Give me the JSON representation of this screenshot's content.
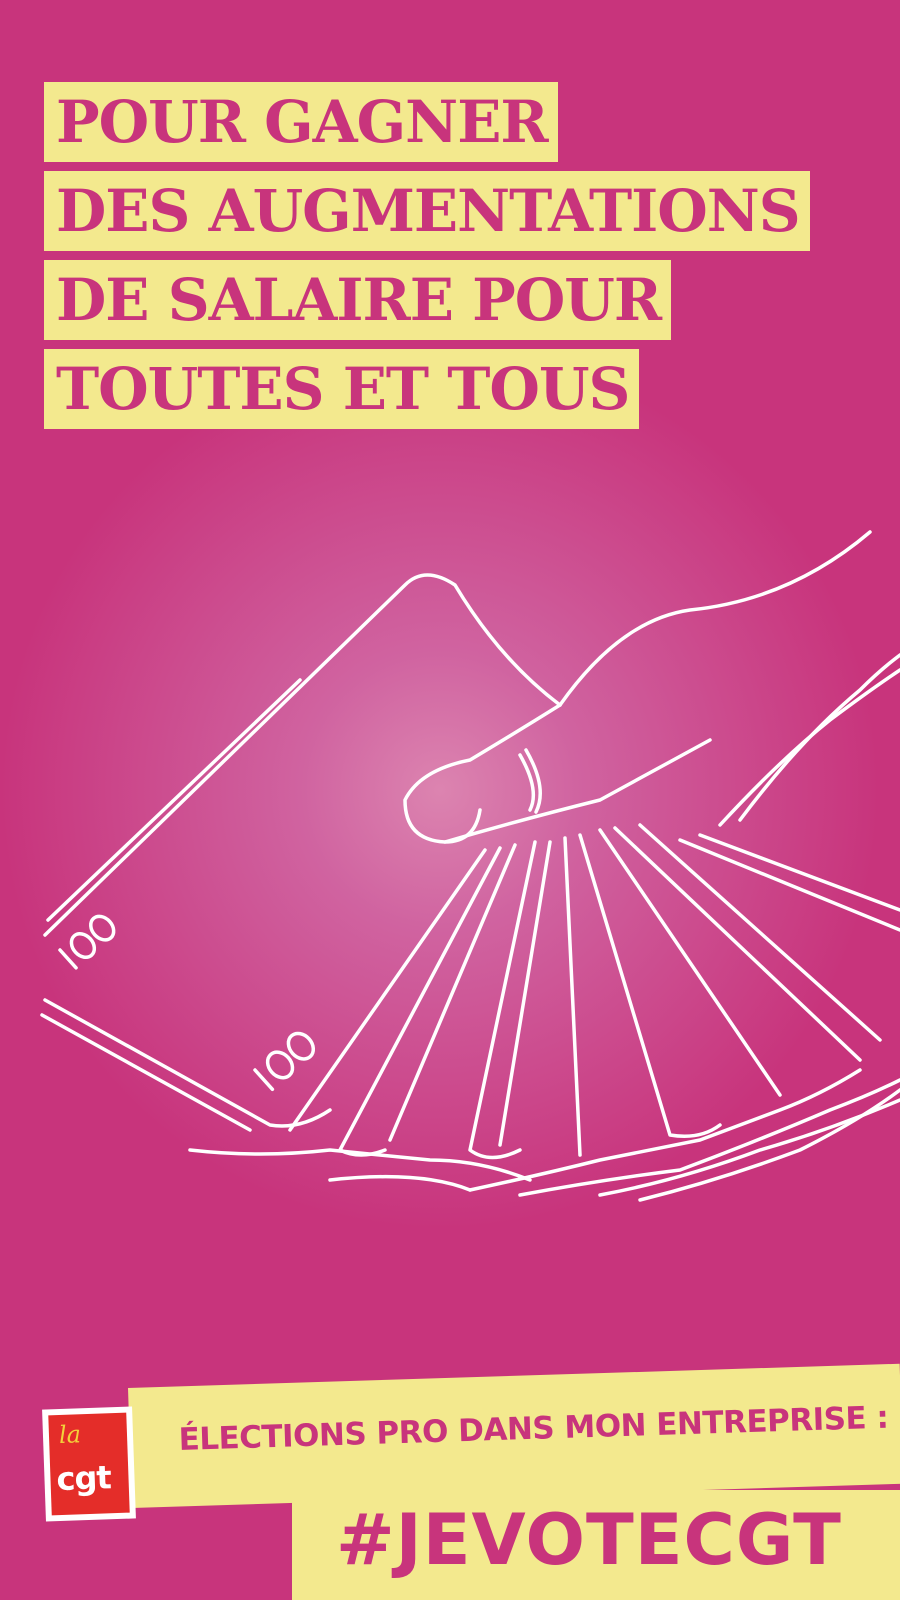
{
  "headline": {
    "lines": [
      "POUR GAGNER",
      "DES AUGMENTATIONS",
      "DE SALAIRE POUR",
      "TOUTES ET TOUS"
    ]
  },
  "illustration": {
    "icon": "hand-holding-banknotes-icon",
    "note_value_top": "100",
    "note_value_bottom": "100"
  },
  "footer": {
    "logo": {
      "la": "la",
      "cgt": "cgt"
    },
    "elections_text": "ÉLECTIONS PRO DANS MON ENTREPRISE :",
    "hashtag": "#JEVOTECGT"
  },
  "colors": {
    "background": "#c8347c",
    "highlight": "#f3e98e",
    "logo_red": "#e42d29",
    "logo_yellow": "#f3d23a",
    "line": "#ffffff"
  }
}
